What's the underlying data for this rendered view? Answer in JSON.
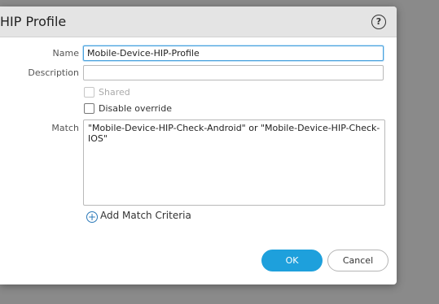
{
  "dialog": {
    "title": "HIP Profile",
    "help_icon": "?"
  },
  "form": {
    "name_label": "Name",
    "name_value": "Mobile-Device-HIP-Profile",
    "description_label": "Description",
    "description_value": "",
    "shared_label": "Shared",
    "disable_override_label": "Disable override",
    "match_label": "Match",
    "match_value": "\"Mobile-Device-HIP-Check-Android\" or \"Mobile-Device-HIP-Check-IOS\"",
    "add_match_label": "Add Match Criteria"
  },
  "buttons": {
    "ok_label": "OK",
    "cancel_label": "Cancel"
  }
}
